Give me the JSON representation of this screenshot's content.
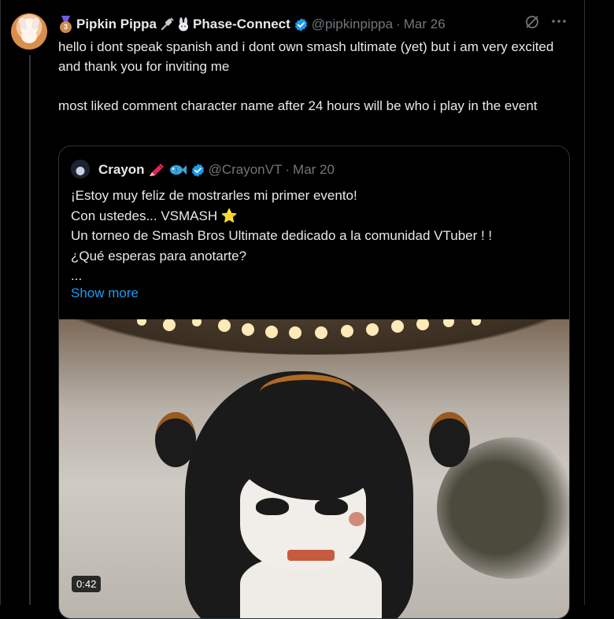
{
  "tweet": {
    "display_name": "Pipkin Pippa",
    "display_name_suffix": "Phase-Connect",
    "handle": "@pipkinpippa",
    "separator": "·",
    "date": "Mar 26",
    "text": "hello i dont speak spanish and i dont own smash ultimate (yet) but i am very excited and thank you for inviting me\n\nmost liked comment character name after 24 hours will be who i play in the event",
    "icons": [
      "medal-icon",
      "plug-icon",
      "bunny-icon",
      "verified-icon",
      "grok-icon",
      "more-icon"
    ],
    "medal_number": "3"
  },
  "quote": {
    "display_name": "Crayon",
    "handle": "@CrayonVT",
    "separator": "·",
    "date": "Mar 20",
    "text_before_star": "¡Estoy muy feliz de mostrarles mi primer evento!\nCon ustedes... VSMASH ",
    "star": "⭐",
    "text_after_star": "\nUn torneo de Smash Bros Ultimate dedicado a la comunidad VTuber ! !\n¿Qué esperas para anotarte?\n...",
    "show_more_label": "Show more",
    "video_duration": "0:42",
    "icons": [
      "crayon-icon",
      "fish-icon",
      "verified-icon"
    ]
  },
  "colors": {
    "background": "#000000",
    "text": "#e7e9ea",
    "secondary_text": "#71767b",
    "link": "#1d9bf0",
    "border": "#2f3336",
    "verified": "#1d9bf0"
  }
}
